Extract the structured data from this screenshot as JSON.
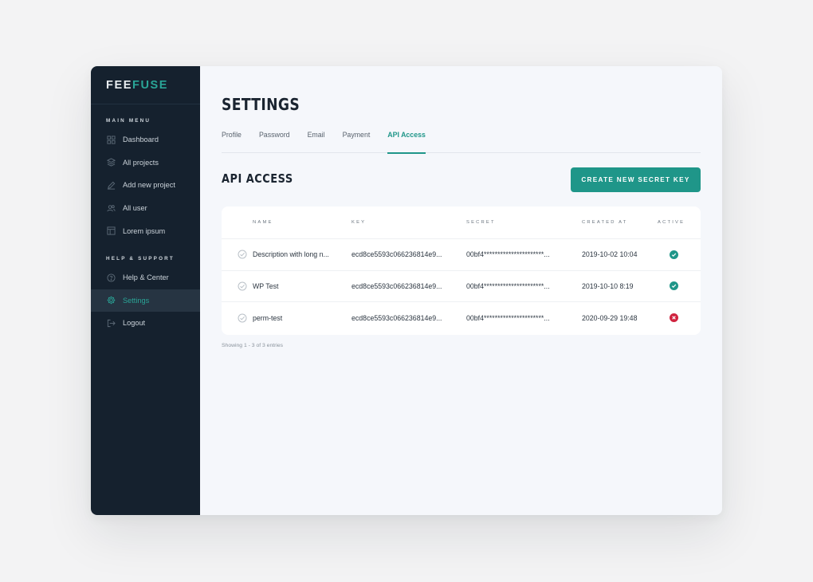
{
  "app": {
    "logo_part1": "FEE",
    "logo_part2": "FUSE"
  },
  "sidebar": {
    "main_menu_label": "MAIN MENU",
    "main_items": [
      {
        "label": "Dashboard",
        "icon": "dashboard-icon"
      },
      {
        "label": "All projects",
        "icon": "layers-icon"
      },
      {
        "label": "Add new project",
        "icon": "pencil-icon"
      },
      {
        "label": "All user",
        "icon": "users-icon"
      },
      {
        "label": "Lorem ipsum",
        "icon": "layout-icon"
      }
    ],
    "support_label": "HELP & SUPPORT",
    "support_items": [
      {
        "label": "Help & Center",
        "icon": "help-icon"
      },
      {
        "label": "Settings",
        "icon": "gear-icon",
        "active": true
      },
      {
        "label": "Logout",
        "icon": "logout-icon"
      }
    ]
  },
  "main": {
    "title": "SETTINGS",
    "tabs": [
      {
        "label": "Profile"
      },
      {
        "label": "Password"
      },
      {
        "label": "Email"
      },
      {
        "label": "Payment"
      },
      {
        "label": "API Access",
        "active": true
      }
    ],
    "section_title": "API ACCESS",
    "create_button": "CREATE NEW SECRET KEY",
    "table": {
      "headers": {
        "name": "NAME",
        "key": "KEY",
        "secret": "SECRET",
        "created_at": "CREATED AT",
        "active": "ACTIVE"
      },
      "rows": [
        {
          "name": "Description with long n...",
          "key": "ecd8ce5593c066236814e9...",
          "secret": "00bf4**********************...",
          "created_at": "2019-10-02 10:04",
          "active": true
        },
        {
          "name": "WP Test",
          "key": "ecd8ce5593c066236814e9...",
          "secret": "00bf4**********************...",
          "created_at": "2019-10-10 8:19",
          "active": true
        },
        {
          "name": "perm-test",
          "key": "ecd8ce5593c066236814e9...",
          "secret": "00bf4**********************...",
          "created_at": "2020-09-29 19:48",
          "active": false
        }
      ]
    },
    "footer_note": "Showing 1 - 3 of 3 entries"
  },
  "colors": {
    "accent": "#1f9689",
    "sidebar_bg": "#15212e",
    "active_green": "#1f9689",
    "inactive_red": "#d0233f"
  }
}
